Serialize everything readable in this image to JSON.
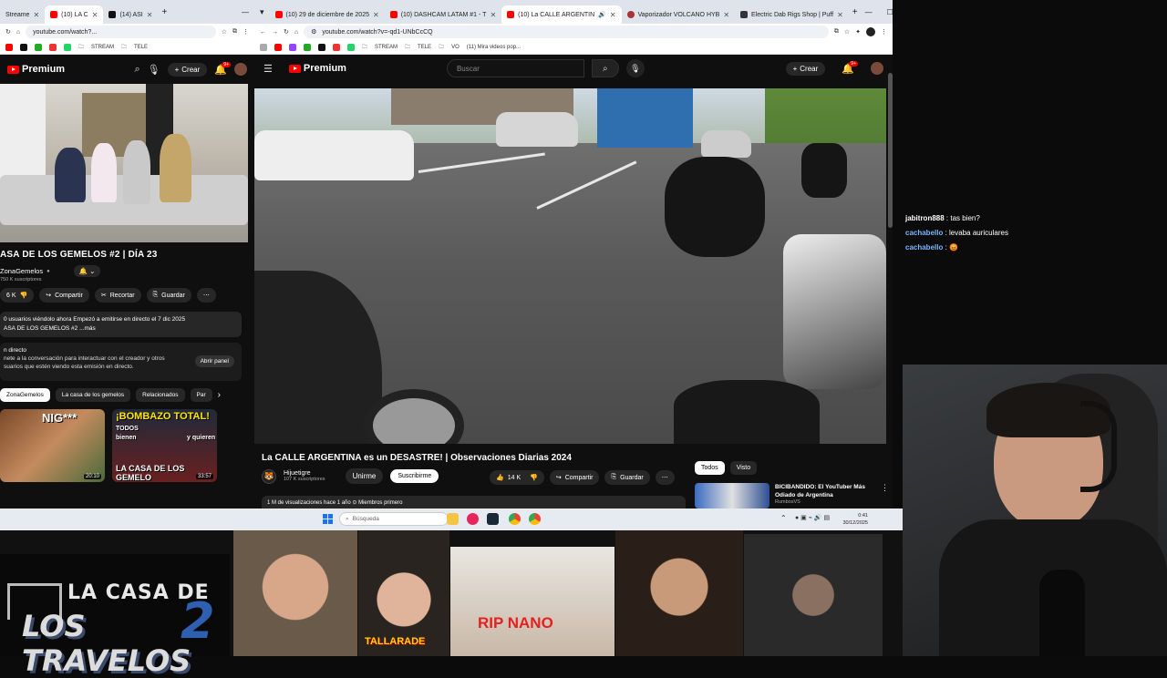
{
  "left_browser": {
    "tabs": [
      {
        "label": "Streame"
      },
      {
        "label": "(10) LA C"
      },
      {
        "label": "(14) ASI"
      }
    ],
    "url": "youtube.com/watch?...",
    "bookmarks": [
      "STREAM",
      "TELE"
    ],
    "logo": "Premium",
    "create_label": "Crear",
    "notif_count": "9+",
    "video_title": "ASA DE LOS GEMELOS #2 | DÍA 23",
    "channel": "ZonaGemelos",
    "subscribers": "750 K suscriptores",
    "likes": "6 K",
    "actions": [
      "Compartir",
      "Recortar",
      "Guardar"
    ],
    "desc_line1": "0 usuarios viéndolo ahora  Empezó a emitirse en directo el 7 dic 2025",
    "desc_line2": "ASA DE LOS GEMELOS #2 ...más",
    "live_head": "n directo",
    "live_text1": "nete a la conversación para interactuar con el creador y otros",
    "live_text2": "suarios que estén viendo esta emisión en directo.",
    "open_panel": "Abrir panel",
    "chips": [
      "ZonaGemelos",
      "La casa de los gemelos",
      "Relacionados",
      "Par"
    ],
    "thumb1": {
      "text": "NIG***",
      "duration": "20:10"
    },
    "thumb2": {
      "text1": "¡BOMBAZO TOTAL!",
      "text2": "LA CASA DE LOS GEMELO",
      "duration": "33:57",
      "side1": "TODOS",
      "side2": "bienen",
      "side3": "y quieren"
    }
  },
  "right_browser": {
    "tabs": [
      {
        "label": "(10) 29 de diciembre de 2025"
      },
      {
        "label": "(10) DASHCAM LATAM #1 - T"
      },
      {
        "label": "(10) La CALLE ARGENTIN"
      },
      {
        "label": "Vaporizador VOLCANO HYB"
      },
      {
        "label": "Electric Dab Rigs Shop | Puff"
      }
    ],
    "url": "youtube.com/watch?v=-qd1-UNbCcCQ",
    "bookmarks": [
      "STREAM",
      "TELE",
      "VO",
      "(11) Mira videos pop..."
    ],
    "logo": "Premium",
    "search_placeholder": "Buscar",
    "create_label": "Crear",
    "notif_count": "9+",
    "video_title": "La CALLE ARGENTINA es un DESASTRE! | Observaciones Diarias 2024",
    "channel": "Hijuetigre",
    "subscribers": "107 K suscriptores",
    "join": "Unirme",
    "subscribe": "Suscribirme",
    "likes": "14 K",
    "share": "Compartir",
    "save": "Guardar",
    "desc": "1 M de visualizaciones  hace 1 año  ⊙ Miembros primero",
    "side_chips": [
      "Todos",
      "Visto"
    ],
    "rec_title": "BICIBANDIDO: El YouTuber Más Odiado de Argentina",
    "rec_channel": "RumbosVS"
  },
  "taskbar": {
    "search": "Búsqueda",
    "time": "0:41",
    "date": "30/12/2025"
  },
  "chat": [
    {
      "user": "jabitron888",
      "msg": "tas bien?",
      "color": "#ffffff"
    },
    {
      "user": "cachabello",
      "msg": "levaba auriculares",
      "color": "#7ab6ff"
    },
    {
      "user": "cachabello",
      "msg": "😡",
      "color": "#7ab6ff"
    }
  ],
  "bottom": {
    "logo_line1": "LA CASA DE",
    "logo_line2": "LOS TRAVELOS",
    "logo_num": "2",
    "cap_tallarade": "TALLARADE",
    "cap_rip": "RIP NANO"
  }
}
